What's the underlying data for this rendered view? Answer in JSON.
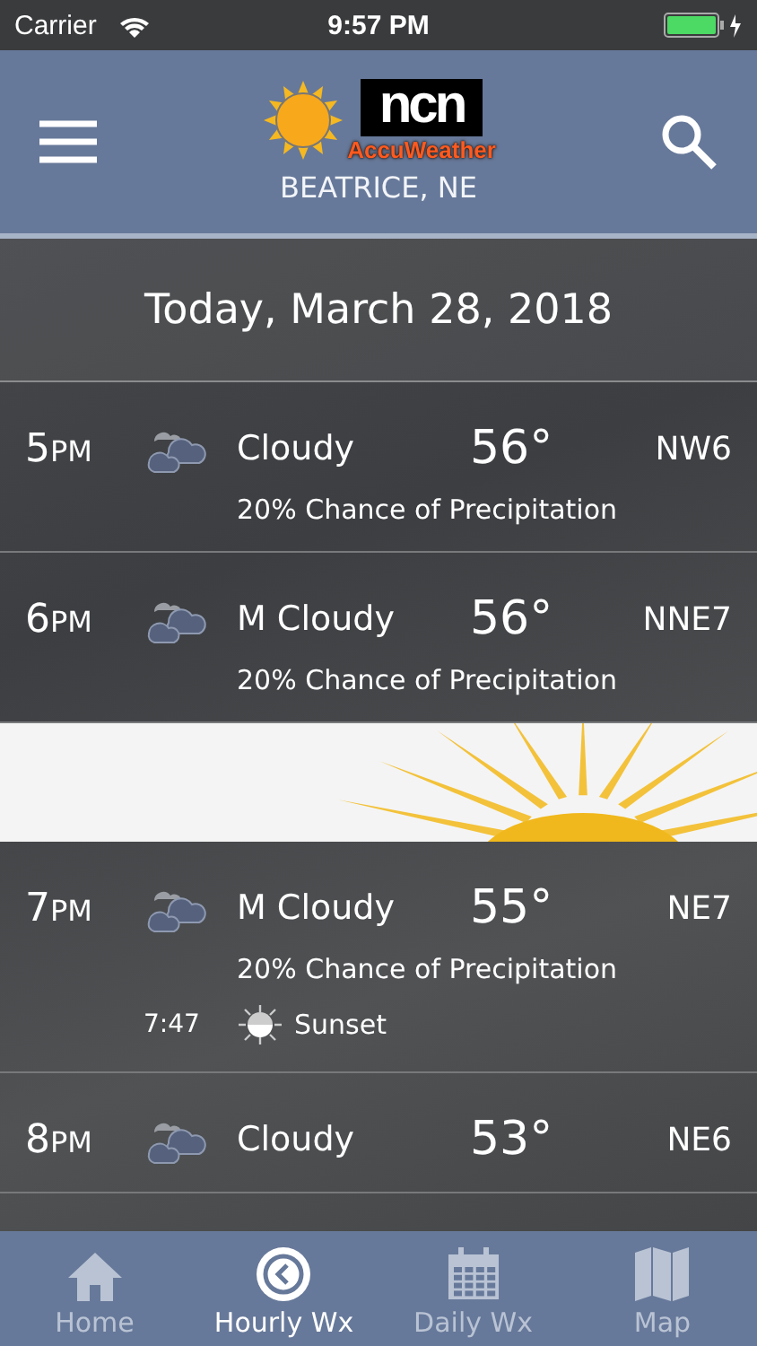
{
  "status_bar": {
    "carrier": "Carrier",
    "time": "9:57 PM"
  },
  "header": {
    "logo": {
      "brand": "ncn",
      "partner": "AccuWeather"
    },
    "location": "BEATRICE, NE"
  },
  "date": "Today, March 28, 2018",
  "hours": [
    {
      "hour": "5",
      "suffix": "PM",
      "condition": "Cloudy",
      "temp": "56°",
      "wind": "NW6",
      "precip": "20% Chance of Precipitation"
    },
    {
      "hour": "6",
      "suffix": "PM",
      "condition": "M Cloudy",
      "temp": "56°",
      "wind": "NNE7",
      "precip": "20% Chance of Precipitation"
    },
    {
      "kind": "picture"
    },
    {
      "hour": "7",
      "suffix": "PM",
      "condition": "M Cloudy",
      "temp": "55°",
      "wind": "NE7",
      "precip": "20% Chance of Precipitation",
      "event": {
        "time": "7:47",
        "label": "Sunset"
      }
    },
    {
      "hour": "8",
      "suffix": "PM",
      "condition": "Cloudy",
      "temp": "53°",
      "wind": "NE6"
    }
  ],
  "tabs": [
    {
      "label": "Home",
      "kind": "home",
      "selected": false
    },
    {
      "label": "Hourly Wx",
      "kind": "clock",
      "selected": true
    },
    {
      "label": "Daily Wx",
      "kind": "calendar",
      "selected": false
    },
    {
      "label": "Map",
      "kind": "map",
      "selected": false
    }
  ]
}
